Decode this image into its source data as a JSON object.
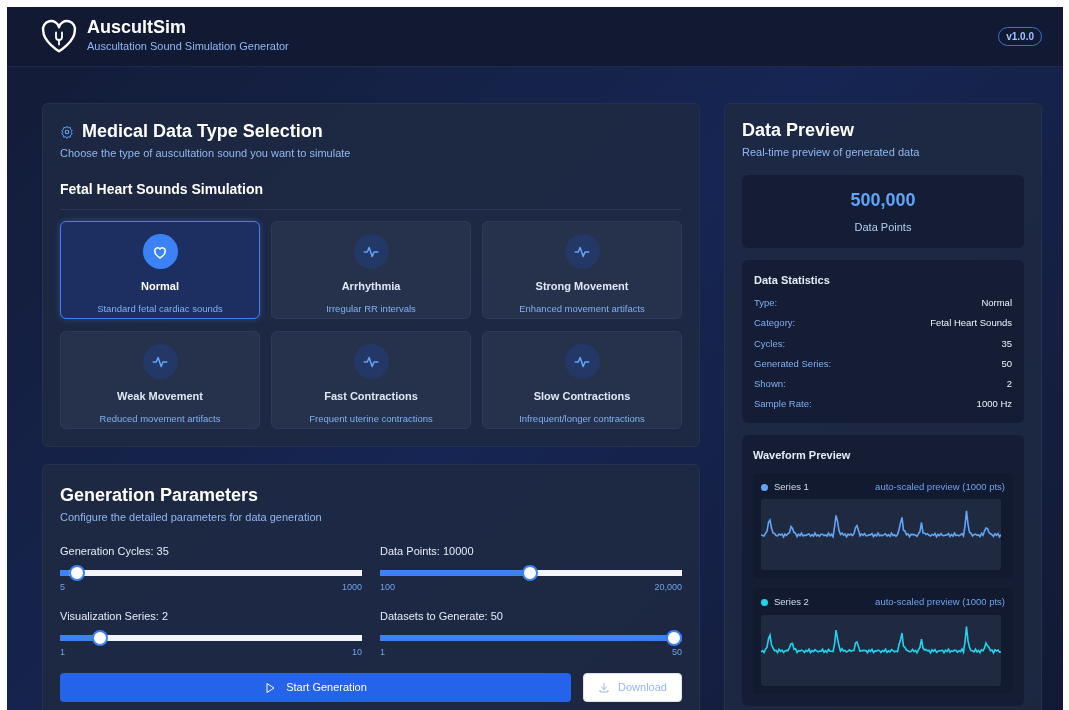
{
  "header": {
    "title": "AuscultSim",
    "subtitle": "Auscultation Sound Simulation Generator",
    "version": "v1.0.0"
  },
  "type_selection": {
    "title": "Medical Data Type Selection",
    "subtitle": "Choose the type of auscultation sound you want to simulate",
    "group": "Fetal Heart Sounds Simulation",
    "types": [
      {
        "name": "Normal",
        "description": "Standard fetal cardiac sounds",
        "selected": true
      },
      {
        "name": "Arrhythmia",
        "description": "Irregular RR intervals",
        "selected": false
      },
      {
        "name": "Strong Movement",
        "description": "Enhanced movement artifacts",
        "selected": false
      },
      {
        "name": "Weak Movement",
        "description": "Reduced movement artifacts",
        "selected": false
      },
      {
        "name": "Fast Contractions",
        "description": "Frequent uterine contractions",
        "selected": false
      },
      {
        "name": "Slow Contractions",
        "description": "Infrequent/longer contractions",
        "selected": false
      }
    ]
  },
  "parameters": {
    "title": "Generation Parameters",
    "subtitle": "Configure the detailed parameters for data generation",
    "sliders": [
      {
        "label": "Generation Cycles: 35",
        "level": 0.03,
        "min": "5",
        "max": "1000"
      },
      {
        "label": "Data Points: 10000",
        "level": 0.497,
        "min": "100",
        "max": "20,000"
      },
      {
        "label": "Visualization Series: 2",
        "level": 0.111,
        "min": "1",
        "max": "10"
      },
      {
        "label": "Datasets to Generate: 50",
        "level": 1,
        "min": "1",
        "max": "50"
      }
    ],
    "start_button": "Start Generation",
    "download_button": {
      "label": "Download",
      "disabled": true
    }
  },
  "preview": {
    "title": "Data Preview",
    "subtitle": "Real-time preview of generated data",
    "total": "500,000",
    "total_label": "Data Points",
    "statistics": {
      "title": "Data Statistics",
      "rows": [
        {
          "label": "Type:",
          "value": "Normal"
        },
        {
          "label": "Category:",
          "value": "Fetal Heart Sounds"
        },
        {
          "label": "Cycles:",
          "value": "35"
        },
        {
          "label": "Generated Series:",
          "value": "50"
        },
        {
          "label": "Shown:",
          "value": "2"
        },
        {
          "label": "Sample Rate:",
          "value": "1000 Hz"
        }
      ]
    },
    "waveforms": {
      "title": "Waveform Preview",
      "series": [
        {
          "name": "Series 1",
          "note": "auto-scaled preview (1000 pts)",
          "color": "#60a5fa"
        },
        {
          "name": "Series 2",
          "note": "auto-scaled preview (1000 pts)",
          "color": "#22d3ee"
        }
      ]
    }
  }
}
